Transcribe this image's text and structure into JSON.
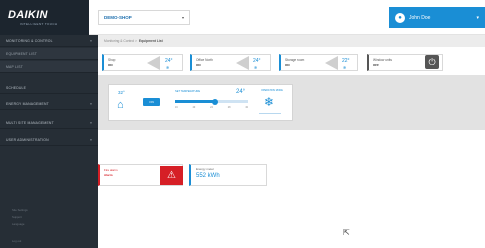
{
  "brand": {
    "name": "DAIKIN",
    "tagline": "INTELLIGENT TOUCH"
  },
  "header": {
    "site_select": "DEMO-SHOP",
    "user_name": "John Doe"
  },
  "sidebar": {
    "items": [
      {
        "label": "MONITORING & CONTROL"
      },
      {
        "label": "EQUIPMENT LIST"
      },
      {
        "label": "MAP LIST"
      },
      {
        "label": "SCHEDULE"
      },
      {
        "label": "ENERGY MANAGEMENT"
      },
      {
        "label": "MULTI SITE MANAGEMENT"
      },
      {
        "label": "USER ADMINISTRATION"
      }
    ],
    "footer": [
      "Site Settings",
      "Support",
      "Language",
      "Log out"
    ]
  },
  "breadcrumb": {
    "path": "Monitoring & Control  >",
    "current": "Equipment List"
  },
  "units": [
    {
      "name": "Shop",
      "state": "ON",
      "temp": "24°"
    },
    {
      "name": "Office North",
      "state": "ON",
      "temp": "24°"
    },
    {
      "name": "Storage room",
      "state": "ON",
      "temp": "22°"
    },
    {
      "name": "Window units",
      "state": "OFF"
    }
  ],
  "detail": {
    "room_temp": "32°",
    "toggle": "ON",
    "setpoint_label": "SET TEMPERATURE",
    "setpoint_value": "24°",
    "setpoint_fraction": 0.55,
    "ticks": [
      "16",
      "20",
      "24",
      "28",
      "32"
    ],
    "condition_label": "OPERATION MODE"
  },
  "alarm": {
    "label": "Fire alarm",
    "value": "Alarm"
  },
  "energy": {
    "label": "Energy meter",
    "value": "552 kWh"
  },
  "colors": {
    "accent": "#1a8ed5",
    "alarm": "#d61f26",
    "sidebar": "#262e36"
  }
}
